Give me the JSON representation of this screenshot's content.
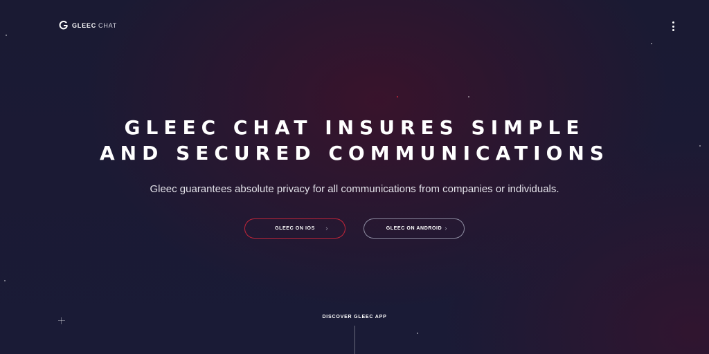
{
  "header": {
    "brand_strong": "GLEEC",
    "brand_light": "CHAT"
  },
  "hero": {
    "title_line1": "GLEEC CHAT INSURES SIMPLE",
    "title_line2": "AND SECURED COMMUNICATIONS",
    "subtitle": "Gleec guarantees absolute privacy for all communications from companies or individuals."
  },
  "actions": {
    "ios_label": "GLEEC ON IOS",
    "android_label": "GLEEC ON ANDROID",
    "chevron": "›"
  },
  "discover": {
    "label": "DISCOVER GLEEC APP"
  },
  "colors": {
    "background": "#1a1a33",
    "accent_red": "#c3253a",
    "outline_gray": "#8f8ea3"
  },
  "icons": {
    "logo": "gleec-logo-icon",
    "menu": "more-vertical-icon",
    "chevron": "chevron-right-icon",
    "decor": "plus-icon"
  }
}
